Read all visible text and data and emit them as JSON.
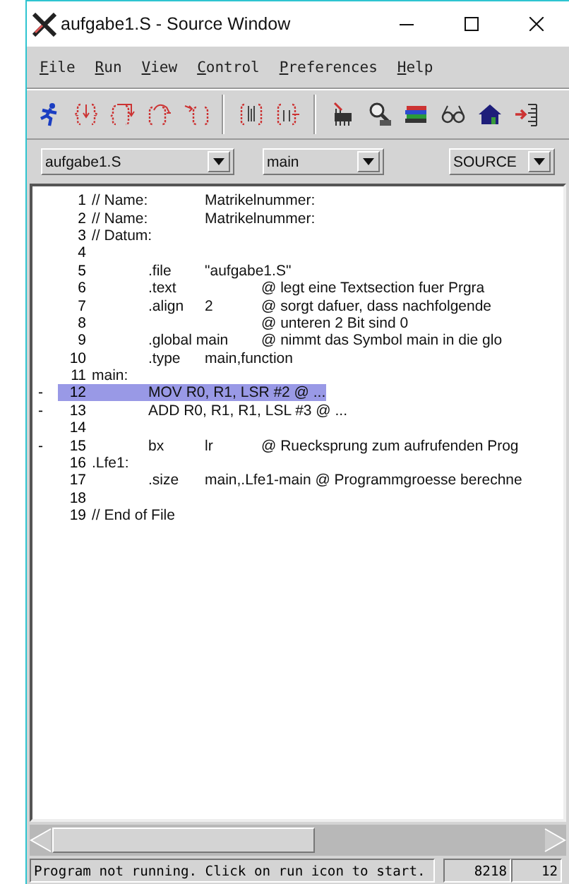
{
  "window": {
    "title": "aufgabe1.S - Source Window"
  },
  "menu": [
    "File",
    "Run",
    "View",
    "Control",
    "Preferences",
    "Help"
  ],
  "toolbar": [
    {
      "kind": "run"
    },
    {
      "kind": "step"
    },
    {
      "kind": "next"
    },
    {
      "kind": "finish"
    },
    {
      "kind": "continue"
    },
    {
      "kind": "up"
    },
    {
      "kind": "down"
    },
    {
      "kind": "registers"
    },
    {
      "kind": "memory"
    },
    {
      "kind": "stack"
    },
    {
      "kind": "watch"
    },
    {
      "kind": "home"
    },
    {
      "kind": "exit"
    }
  ],
  "selectors": [
    {
      "value": "aufgabe1.S"
    },
    {
      "value": "main"
    },
    {
      "value": "SOURCE"
    }
  ],
  "source_lines": [
    {
      "number": "1",
      "text": "// Name:\tMatrikelnummer:",
      "selected": false
    },
    {
      "number": "2",
      "text": "// Name:\tMatrikelnummer:",
      "selected": false
    },
    {
      "number": "3",
      "text": "// Datum:",
      "selected": false
    },
    {
      "number": "4",
      "selected": false
    },
    {
      "number": "5",
      "text": "\t.file\t\"aufgabe1.S\"",
      "selected": false
    },
    {
      "number": "6",
      "text": "\t.text\t\t@ legt eine Textsection fuer Prgra",
      "selected": false
    },
    {
      "number": "7",
      "text": "\t.align\t2\t@ sorgt dafuer, dass nachfolgende",
      "selected": false
    },
    {
      "number": "8",
      "text": "\t\t\t@ unteren 2 Bit sind 0",
      "selected": false
    },
    {
      "number": "9",
      "text": "\t.global main\t@ nimmt das Symbol main in die glo",
      "selected": false
    },
    {
      "number": "10",
      "text": "\t.type\tmain,function",
      "selected": false
    },
    {
      "number": "11",
      "text": "main:",
      "selected": false
    },
    {
      "number": "12",
      "marker": "-",
      "text": "\tMOV R0, R1, LSR #2 @ ...",
      "selected": true
    },
    {
      "number": "13",
      "marker": "-",
      "text": "\tADD R0, R1, R1, LSL #3 @ ...",
      "selected": false
    },
    {
      "number": "14",
      "selected": false
    },
    {
      "number": "15",
      "marker": "-",
      "text": "\tbx\tlr\t@ Ruecksprung zum aufrufenden Prog",
      "selected": false
    },
    {
      "number": "16",
      "text": ".Lfe1:",
      "selected": false
    },
    {
      "number": "17",
      "text": "\t.size\tmain,.Lfe1-main @ Programmgroesse berechne",
      "selected": false
    },
    {
      "number": "18",
      "selected": false
    },
    {
      "number": "19",
      "text": "// End of File",
      "selected": false
    }
  ],
  "status_bar": {
    "message": "Program not running. Click on run icon to start.",
    "field_1": "8218",
    "field_2": "12"
  }
}
